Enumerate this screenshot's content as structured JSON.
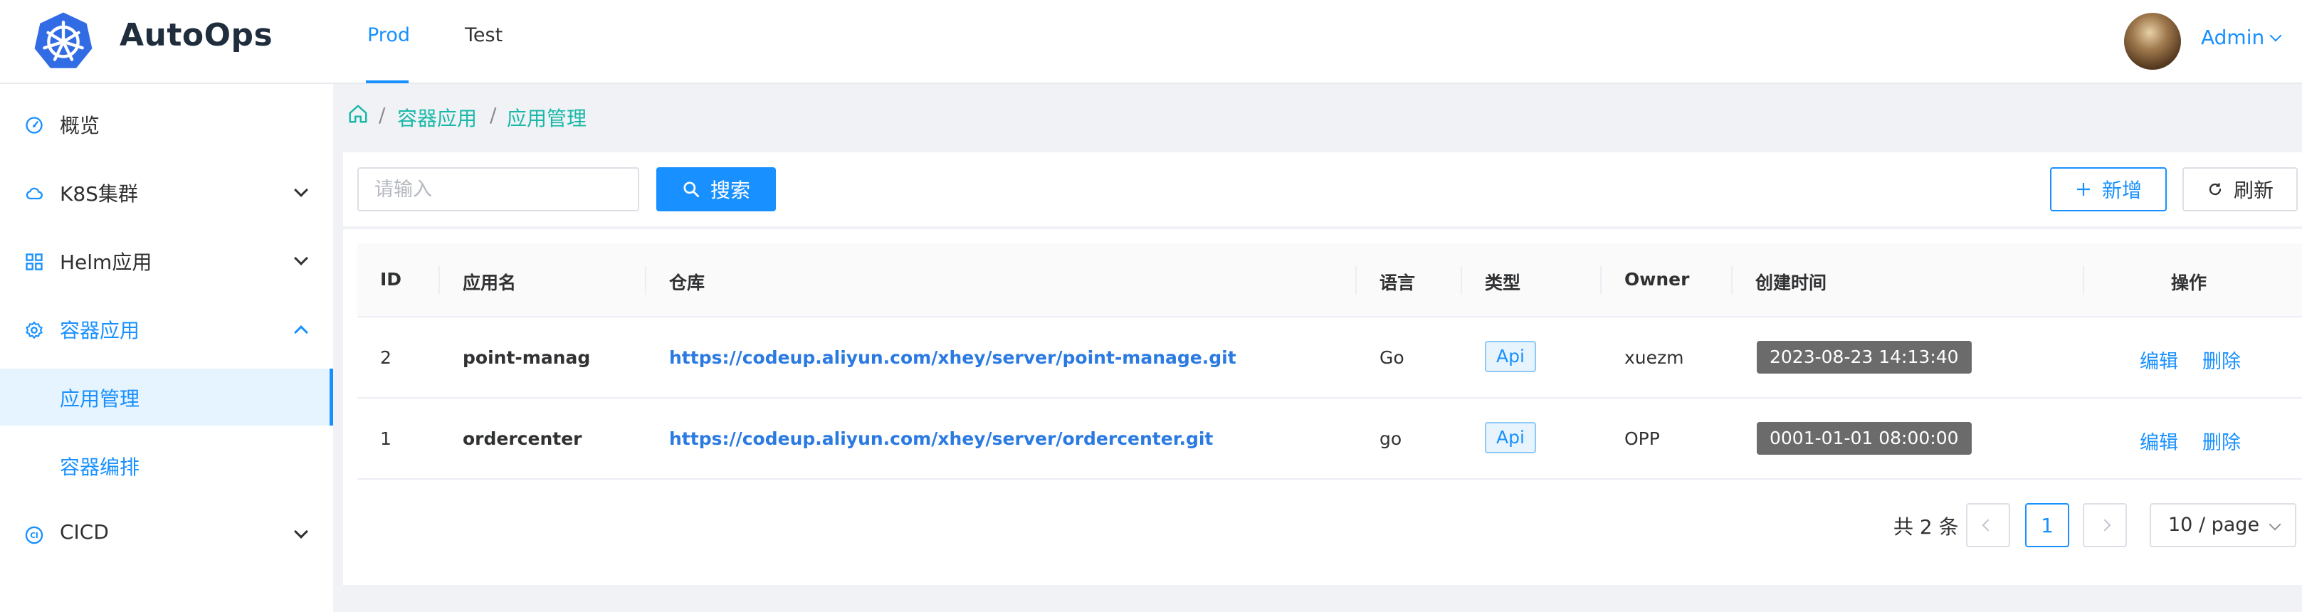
{
  "header": {
    "brand": "AutoOps",
    "logo_icon": "kubernetes-helm-icon",
    "tabs": [
      {
        "label": "Prod",
        "active": true
      },
      {
        "label": "Test",
        "active": false
      }
    ],
    "user": {
      "name": "Admin",
      "avatar_icon": "user-avatar"
    }
  },
  "sidebar": {
    "items": [
      {
        "label": "概览",
        "icon": "dashboard-icon"
      },
      {
        "label": "K8S集群",
        "icon": "cloud-icon",
        "expandable": true
      },
      {
        "label": "Helm应用",
        "icon": "grid-icon",
        "expandable": true
      },
      {
        "label": "容器应用",
        "icon": "gear-icon",
        "expandable": true,
        "expanded": true,
        "children": [
          {
            "label": "应用管理",
            "active": true
          },
          {
            "label": "容器编排",
            "active": false
          }
        ]
      },
      {
        "label": "CICD",
        "icon": "cicd-icon",
        "expandable": true
      }
    ]
  },
  "breadcrumb": [
    "容器应用",
    "应用管理"
  ],
  "toolbar": {
    "search_placeholder": "请输入",
    "search_value": "",
    "search_label": "搜索",
    "add_label": "新增",
    "refresh_label": "刷新"
  },
  "table": {
    "columns": [
      "ID",
      "应用名",
      "仓库",
      "语言",
      "类型",
      "Owner",
      "创建时间",
      "操作"
    ],
    "rows": [
      {
        "id": "2",
        "name": "point-manag",
        "repo": "https://codeup.aliyun.com/xhey/server/point-manage.git",
        "lang": "Go",
        "type": "Api",
        "owner": "xuezm",
        "created": "2023-08-23 14:13:40"
      },
      {
        "id": "1",
        "name": "ordercenter",
        "repo": "https://codeup.aliyun.com/xhey/server/ordercenter.git",
        "lang": "go",
        "type": "Api",
        "owner": "OPP",
        "created": "0001-01-01 08:00:00"
      }
    ],
    "actions": {
      "edit": "编辑",
      "delete": "删除"
    }
  },
  "pagination": {
    "total_label": "共 2 条",
    "current_page": "1",
    "page_size": "10 / page"
  },
  "colors": {
    "primary": "#1890ff",
    "breadcrumb": "#19b8a9",
    "time_badge": "#6b6b6b"
  }
}
